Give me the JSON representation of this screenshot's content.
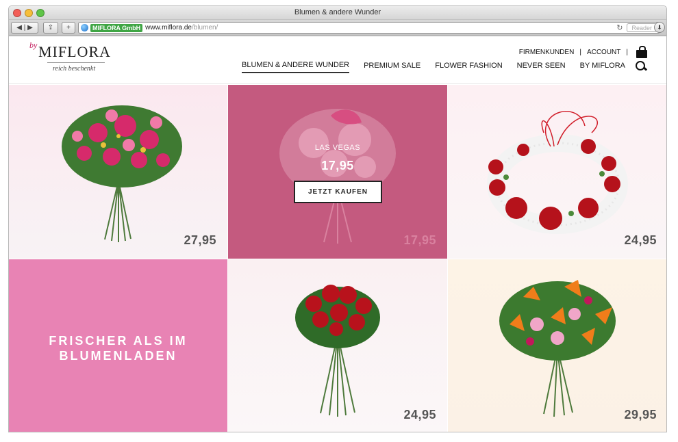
{
  "window": {
    "title": "Blumen & andere Wunder"
  },
  "browser": {
    "ev_label": "MIFLORA GmbH",
    "url_host": "www.miflora.de",
    "url_path": "/blumen/",
    "reader_label": "Reader"
  },
  "logo": {
    "by": "by",
    "name": "MIFLORA",
    "tagline": "reich beschenkt"
  },
  "topnav": {
    "firmenkunden": "FIRMENKUNDEN",
    "sep1": "|",
    "account": "ACCOUNT",
    "sep2": "|"
  },
  "mainnav": {
    "items": [
      "BLUMEN & ANDERE WUNDER",
      "PREMIUM SALE",
      "FLOWER FASHION",
      "NEVER SEEN",
      "BY MIFLORA"
    ]
  },
  "products": [
    {
      "price": "27,95"
    },
    {
      "name": "LAS VEGAS",
      "price": "17,95",
      "overlay_price": "17,95",
      "button": "JETZT KAUFEN"
    },
    {
      "price": "24,95"
    },
    {
      "promo_line1": "FRISCHER ALS IM",
      "promo_line2": "BLUMENLADEN"
    },
    {
      "price": "24,95"
    },
    {
      "price": "29,95"
    }
  ],
  "colors": {
    "overlay": "#c45a7f",
    "promo": "#e883b4",
    "brand": "#c2185b"
  }
}
